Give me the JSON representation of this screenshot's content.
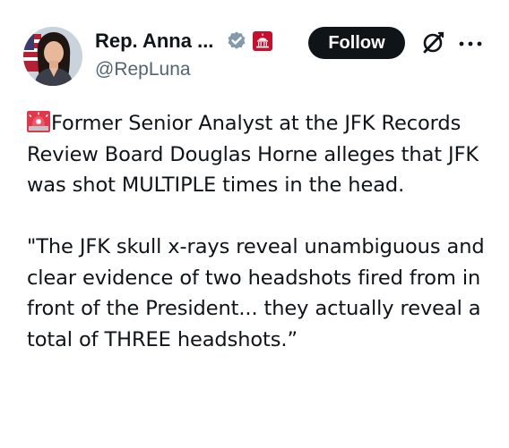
{
  "author": {
    "display_name": "Rep. Anna ...",
    "handle": "@RepLuna",
    "verified_icon": "verified-badge-icon",
    "affiliation_icon": "capitol-building-icon"
  },
  "actions": {
    "follow_label": "Follow",
    "grok_icon": "grok-icon",
    "more_icon": "more-options-icon"
  },
  "tweet": {
    "emoji": "police-siren-icon",
    "paragraph_1": "Former Senior Analyst at the JFK Records Review Board Douglas Horne alleges that JFK was shot MULTIPLE times in the head.",
    "paragraph_2": "\"The JFK skull x-rays reveal unambiguous and clear evidence of two headshots fired from in front of the President... they actually reveal a total of THREE headshots.”"
  },
  "colors": {
    "text_primary": "#0f1419",
    "text_secondary": "#536471",
    "follow_bg": "#0f1419",
    "follow_text": "#ffffff",
    "verified_badge": "#829aab",
    "affiliation_badge": "#c8102e"
  }
}
